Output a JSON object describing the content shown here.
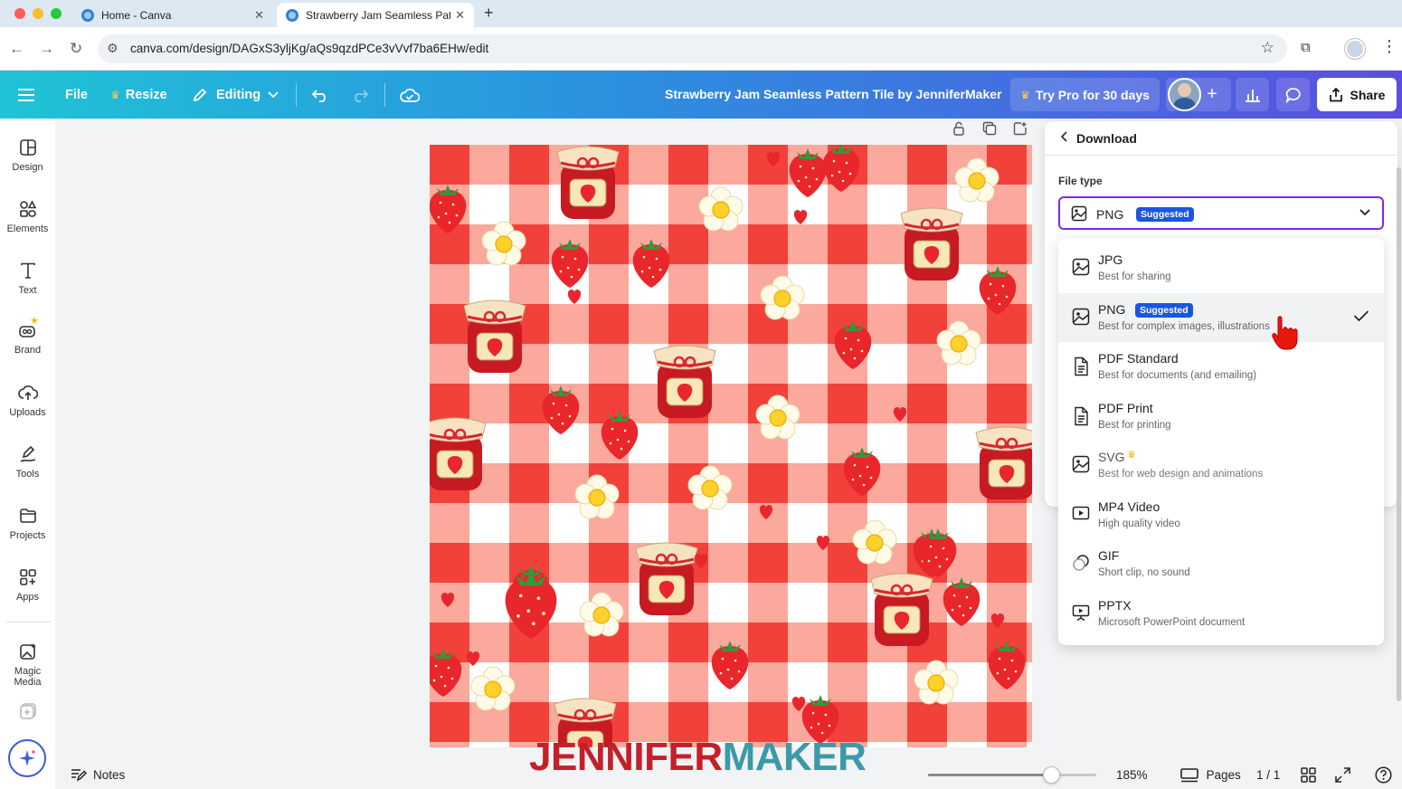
{
  "browser": {
    "tabs": [
      {
        "title": "Home - Canva",
        "active": false
      },
      {
        "title": "Strawberry Jam Seamless Pat",
        "active": true
      }
    ],
    "url": "canva.com/design/DAGxS3yljKg/aQs9qzdPCe3vVvf7ba6EHw/edit"
  },
  "header": {
    "file": "File",
    "resize": "Resize",
    "editing": "Editing",
    "title": "Strawberry Jam Seamless Pattern Tile by JenniferMaker",
    "try_pro": "Try Pro for 30 days",
    "share": "Share"
  },
  "sidebar": {
    "items": [
      {
        "label": "Design",
        "icon": "layout-icon"
      },
      {
        "label": "Elements",
        "icon": "shapes-icon"
      },
      {
        "label": "Text",
        "icon": "text-icon"
      },
      {
        "label": "Brand",
        "icon": "brand-icon"
      },
      {
        "label": "Uploads",
        "icon": "cloud-upload-icon"
      },
      {
        "label": "Tools",
        "icon": "pen-tool-icon"
      },
      {
        "label": "Projects",
        "icon": "folder-icon"
      },
      {
        "label": "Apps",
        "icon": "apps-grid-icon"
      },
      {
        "label": "Magic Media",
        "icon": "magic-media-icon"
      }
    ]
  },
  "canvas": {
    "brand_a": "JENNIFER",
    "brand_b": "MAKER"
  },
  "download_panel": {
    "title": "Download",
    "file_type_label": "File type",
    "selected_type": "PNG",
    "suggested_badge": "Suggested",
    "options": [
      {
        "name": "JPG",
        "desc": "Best for sharing"
      },
      {
        "name": "PNG",
        "desc": "Best for complex images, illustrations",
        "badge": "Suggested",
        "selected": true
      },
      {
        "name": "PDF Standard",
        "desc": "Best for documents (and emailing)"
      },
      {
        "name": "PDF Print",
        "desc": "Best for printing"
      },
      {
        "name": "SVG",
        "desc": "Best for web design and animations",
        "pro": true
      },
      {
        "name": "MP4 Video",
        "desc": "High quality video"
      },
      {
        "name": "GIF",
        "desc": "Short clip, no sound"
      },
      {
        "name": "PPTX",
        "desc": "Microsoft PowerPoint document"
      }
    ]
  },
  "bottom": {
    "notes": "Notes",
    "zoom": "185%",
    "zoom_level": 0.73,
    "pages": "Pages",
    "page_count": "1 / 1"
  },
  "colors": {
    "accent": "#7d2ae8",
    "badge": "#1a55e3",
    "gingham_red": "#f2403a",
    "gingham_light": "#f98b7c"
  }
}
